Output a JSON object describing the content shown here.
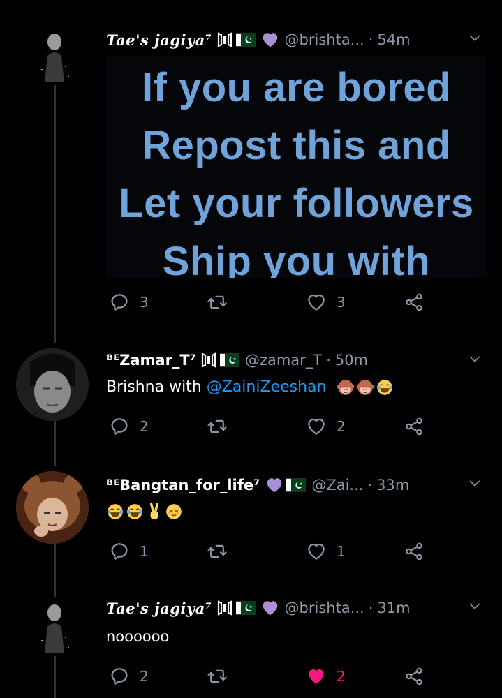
{
  "colors": {
    "background": "#000000",
    "secondary_text": "#8b98a5",
    "link": "#1d9bf0",
    "liked": "#f91880",
    "thread_line": "#2f3336"
  },
  "tweets": [
    {
      "display_name": "Tae's jagiya⁷",
      "handle": "@brishta...",
      "time": "54m",
      "image_lines": [
        "If you are bored",
        "Repost this and",
        "Let your followers",
        "Ship you with"
      ],
      "replies": "3",
      "retweets": "",
      "likes": "3",
      "liked": false
    },
    {
      "display_name": "ᴮᴱZamar_T⁷",
      "handle": "@zamar_T",
      "time": "50m",
      "text_prefix": "Brishna with ",
      "mention": "@ZainiZeeshan",
      "emojis": [
        "see-no-evil-monkey-icon",
        "see-no-evil-monkey-icon",
        "tears-of-joy-icon"
      ],
      "replies": "2",
      "retweets": "",
      "likes": "2",
      "liked": false
    },
    {
      "display_name": "ᴮᴱBangtan_for_life⁷",
      "handle": "@Zai...",
      "time": "33m",
      "emojis": [
        "tears-of-joy-icon",
        "tears-of-joy-icon",
        "victory-hand-icon",
        "relieved-face-icon"
      ],
      "replies": "1",
      "retweets": "",
      "likes": "1",
      "liked": false
    },
    {
      "display_name": "Tae's jagiya⁷",
      "handle": "@brishta...",
      "time": "31m",
      "text": "noooooo",
      "replies": "2",
      "retweets": "",
      "likes": "2",
      "liked": true
    }
  ]
}
